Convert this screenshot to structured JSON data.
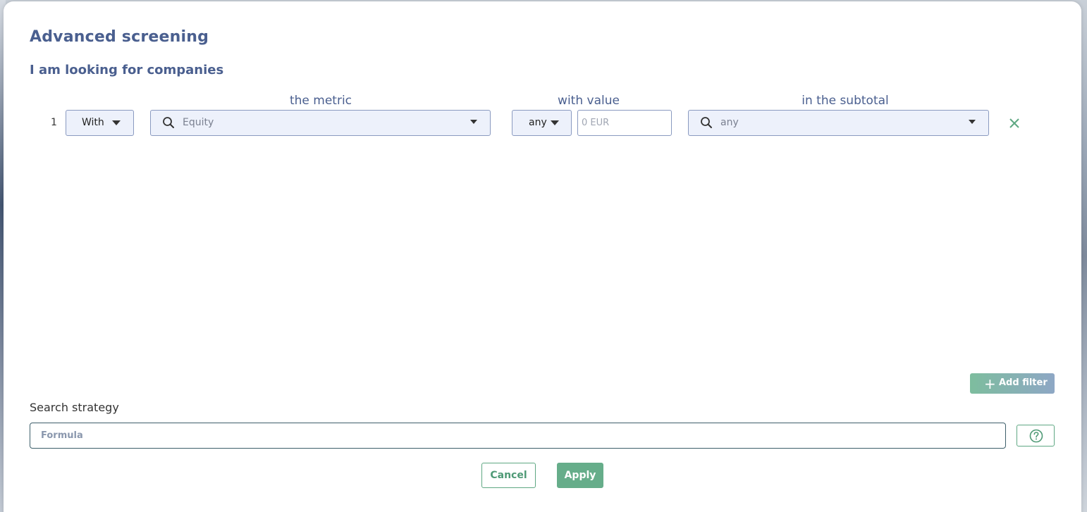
{
  "modal": {
    "title": "Advanced screening",
    "subtitle": "I am looking for companies"
  },
  "columns": {
    "metric": "the metric",
    "value": "with value",
    "subtotal": "in the subtotal"
  },
  "filters": [
    {
      "index": "1",
      "condition": "With",
      "metric_placeholder": "Equity",
      "operator": "any",
      "value_placeholder": "0 EUR",
      "subtotal_placeholder": "any"
    }
  ],
  "add_filter_label": "Add filter",
  "strategy": {
    "label": "Search strategy",
    "placeholder": "Formula"
  },
  "actions": {
    "cancel": "Cancel",
    "apply": "Apply"
  },
  "icons": {
    "search": "search-icon",
    "caret": "chevron-down-icon",
    "remove": "close-icon",
    "add": "plus-icon",
    "help": "help-circle-icon"
  },
  "colors": {
    "title": "#4a5f8f",
    "accent_green": "#66ad8a",
    "field_bg": "#edf1fb",
    "field_border": "#8a9ac0"
  }
}
